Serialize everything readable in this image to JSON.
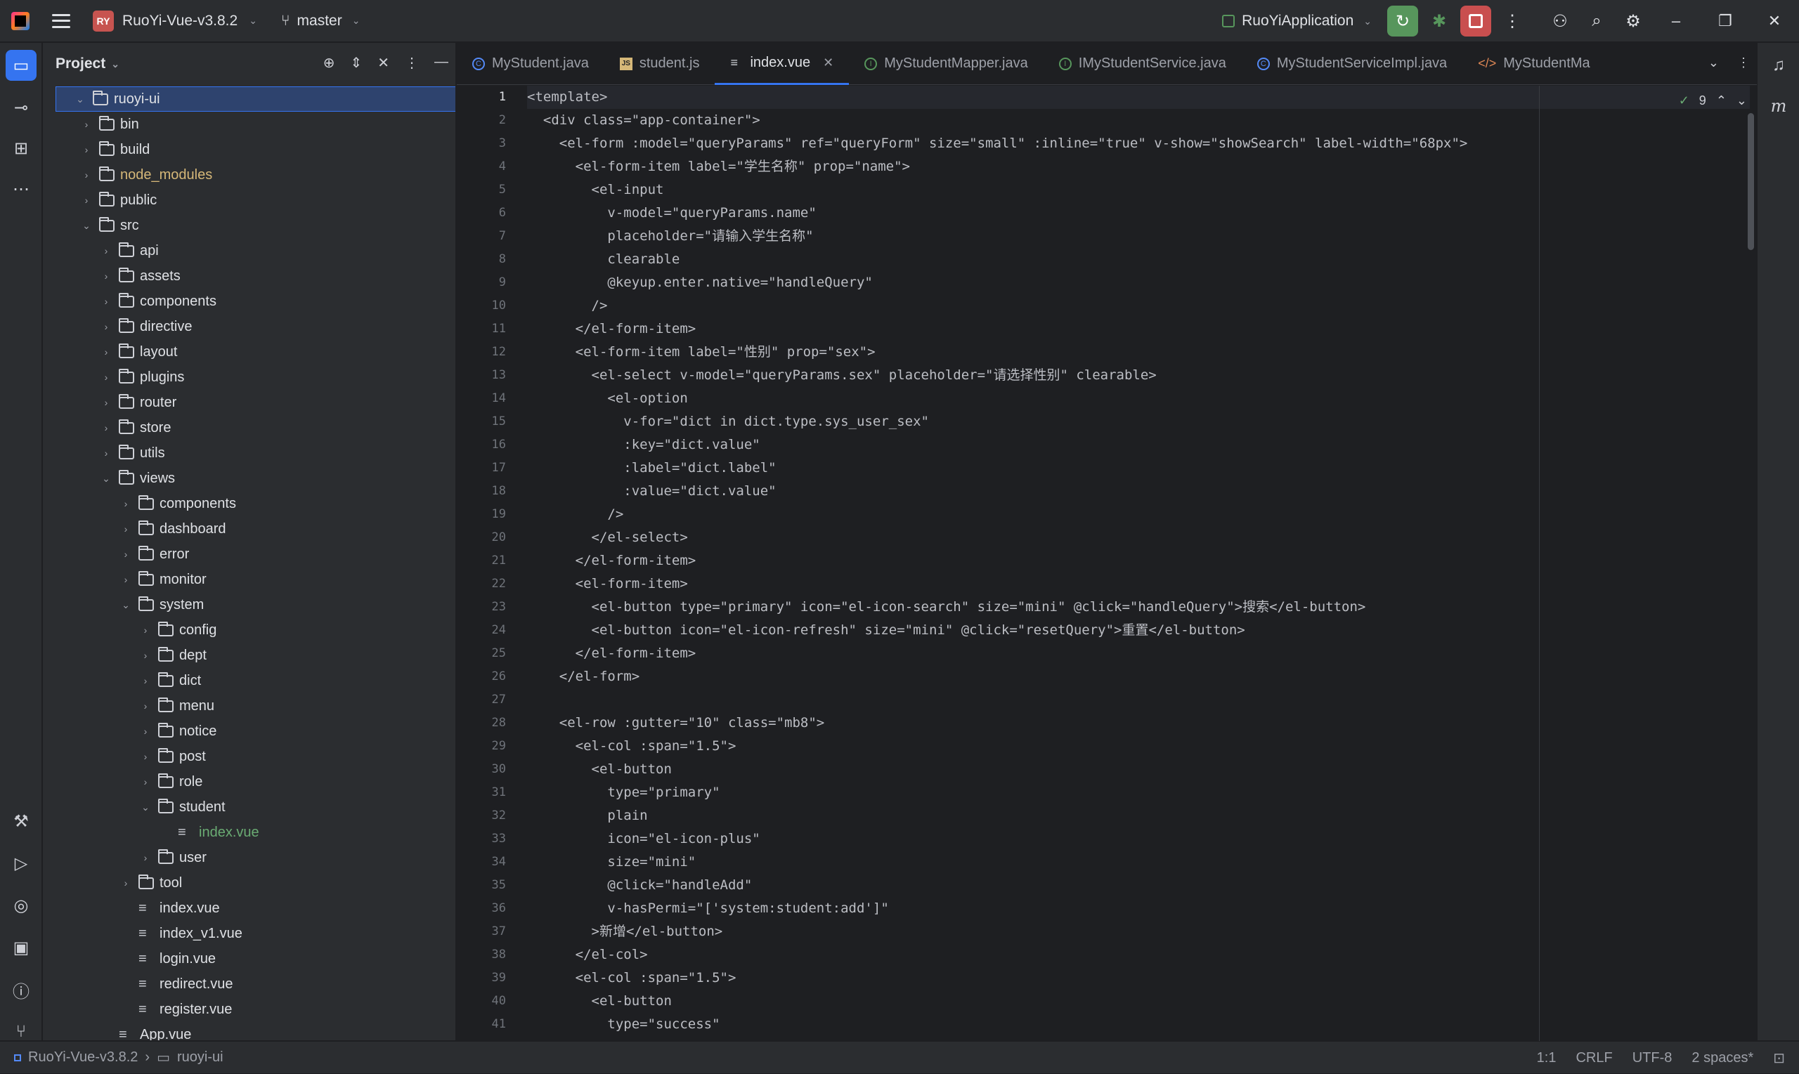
{
  "titlebar": {
    "project_badge": "RY",
    "project_name": "RuoYi-Vue-v3.8.2",
    "branch": "master",
    "run_config": "RuoYiApplication"
  },
  "project_panel": {
    "title": "Project",
    "tree": [
      {
        "label": "ruoyi-ui",
        "type": "folder",
        "depth": 0,
        "expanded": true,
        "selected": true
      },
      {
        "label": "bin",
        "type": "folder",
        "depth": 1
      },
      {
        "label": "build",
        "type": "folder",
        "depth": 1
      },
      {
        "label": "node_modules",
        "type": "folder",
        "depth": 1,
        "color": "excluded"
      },
      {
        "label": "public",
        "type": "folder",
        "depth": 1
      },
      {
        "label": "src",
        "type": "folder",
        "depth": 1,
        "expanded": true
      },
      {
        "label": "api",
        "type": "folder",
        "depth": 2
      },
      {
        "label": "assets",
        "type": "folder",
        "depth": 2
      },
      {
        "label": "components",
        "type": "folder",
        "depth": 2
      },
      {
        "label": "directive",
        "type": "folder",
        "depth": 2
      },
      {
        "label": "layout",
        "type": "folder",
        "depth": 2
      },
      {
        "label": "plugins",
        "type": "folder",
        "depth": 2
      },
      {
        "label": "router",
        "type": "folder",
        "depth": 2
      },
      {
        "label": "store",
        "type": "folder",
        "depth": 2
      },
      {
        "label": "utils",
        "type": "folder",
        "depth": 2
      },
      {
        "label": "views",
        "type": "folder",
        "depth": 2,
        "expanded": true
      },
      {
        "label": "components",
        "type": "folder",
        "depth": 3
      },
      {
        "label": "dashboard",
        "type": "folder",
        "depth": 3
      },
      {
        "label": "error",
        "type": "folder",
        "depth": 3
      },
      {
        "label": "monitor",
        "type": "folder",
        "depth": 3
      },
      {
        "label": "system",
        "type": "folder",
        "depth": 3,
        "expanded": true
      },
      {
        "label": "config",
        "type": "folder",
        "depth": 4
      },
      {
        "label": "dept",
        "type": "folder",
        "depth": 4
      },
      {
        "label": "dict",
        "type": "folder",
        "depth": 4
      },
      {
        "label": "menu",
        "type": "folder",
        "depth": 4
      },
      {
        "label": "notice",
        "type": "folder",
        "depth": 4
      },
      {
        "label": "post",
        "type": "folder",
        "depth": 4
      },
      {
        "label": "role",
        "type": "folder",
        "depth": 4
      },
      {
        "label": "student",
        "type": "folder",
        "depth": 4,
        "expanded": true
      },
      {
        "label": "index.vue",
        "type": "file",
        "depth": 5,
        "color": "new"
      },
      {
        "label": "user",
        "type": "folder",
        "depth": 4
      },
      {
        "label": "tool",
        "type": "folder",
        "depth": 3
      },
      {
        "label": "index.vue",
        "type": "file",
        "depth": 3
      },
      {
        "label": "index_v1.vue",
        "type": "file",
        "depth": 3
      },
      {
        "label": "login.vue",
        "type": "file",
        "depth": 3
      },
      {
        "label": "redirect.vue",
        "type": "file",
        "depth": 3
      },
      {
        "label": "register.vue",
        "type": "file",
        "depth": 3
      },
      {
        "label": "App.vue",
        "type": "file",
        "depth": 2
      }
    ]
  },
  "tabs": [
    {
      "label": "MyStudent.java",
      "icon": "class"
    },
    {
      "label": "student.js",
      "icon": "js"
    },
    {
      "label": "index.vue",
      "icon": "vue",
      "active": true
    },
    {
      "label": "MyStudentMapper.java",
      "icon": "interface"
    },
    {
      "label": "IMyStudentService.java",
      "icon": "interface"
    },
    {
      "label": "MyStudentServiceImpl.java",
      "icon": "class"
    },
    {
      "label": "MyStudentMa",
      "icon": "xml"
    }
  ],
  "inspection": {
    "count": "9"
  },
  "code_lines": [
    "<template>",
    "  <div class=\"app-container\">",
    "    <el-form :model=\"queryParams\" ref=\"queryForm\" size=\"small\" :inline=\"true\" v-show=\"showSearch\" label-width=\"68px\">",
    "      <el-form-item label=\"学生名称\" prop=\"name\">",
    "        <el-input",
    "          v-model=\"queryParams.name\"",
    "          placeholder=\"请输入学生名称\"",
    "          clearable",
    "          @keyup.enter.native=\"handleQuery\"",
    "        />",
    "      </el-form-item>",
    "      <el-form-item label=\"性别\" prop=\"sex\">",
    "        <el-select v-model=\"queryParams.sex\" placeholder=\"请选择性别\" clearable>",
    "          <el-option",
    "            v-for=\"dict in dict.type.sys_user_sex\"",
    "            :key=\"dict.value\"",
    "            :label=\"dict.label\"",
    "            :value=\"dict.value\"",
    "          />",
    "        </el-select>",
    "      </el-form-item>",
    "      <el-form-item>",
    "        <el-button type=\"primary\" icon=\"el-icon-search\" size=\"mini\" @click=\"handleQuery\">搜索</el-button>",
    "        <el-button icon=\"el-icon-refresh\" size=\"mini\" @click=\"resetQuery\">重置</el-button>",
    "      </el-form-item>",
    "    </el-form>",
    "",
    "    <el-row :gutter=\"10\" class=\"mb8\">",
    "      <el-col :span=\"1.5\">",
    "        <el-button",
    "          type=\"primary\"",
    "          plain",
    "          icon=\"el-icon-plus\"",
    "          size=\"mini\"",
    "          @click=\"handleAdd\"",
    "          v-hasPermi=\"['system:student:add']\"",
    "        >新增</el-button>",
    "      </el-col>",
    "      <el-col :span=\"1.5\">",
    "        <el-button",
    "          type=\"success\""
  ],
  "statusbar": {
    "project": "RuoYi-Vue-v3.8.2",
    "module": "ruoyi-ui",
    "position": "1:1",
    "line_sep": "CRLF",
    "encoding": "UTF-8",
    "indent": "2 spaces*"
  }
}
